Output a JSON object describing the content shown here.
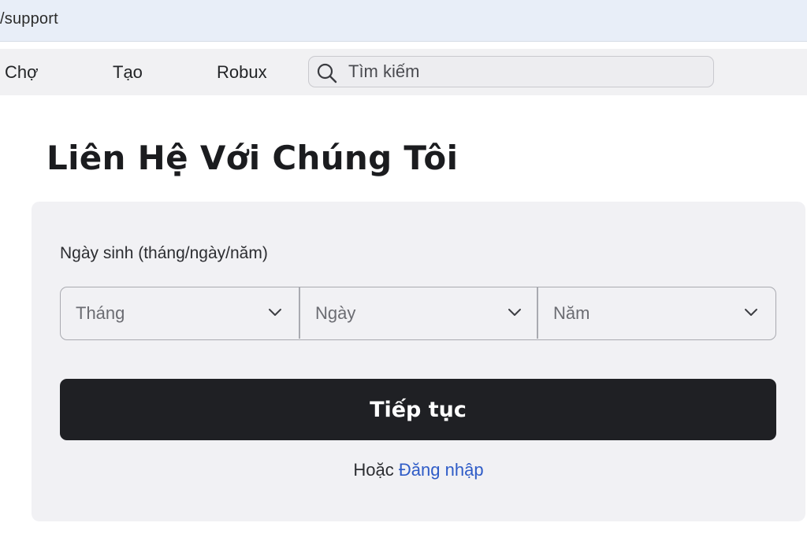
{
  "browser": {
    "url": "/support"
  },
  "nav": {
    "items": [
      {
        "label": "Chợ"
      },
      {
        "label": "Tạo"
      },
      {
        "label": "Robux"
      }
    ],
    "search_placeholder": "Tìm kiếm",
    "search_icon": "search-icon"
  },
  "page": {
    "title": "Liên Hệ Với Chúng Tôi"
  },
  "form": {
    "dob_label": "Ngày sinh (tháng/ngày/năm)",
    "month_placeholder": "Tháng",
    "day_placeholder": "Ngày",
    "year_placeholder": "Năm",
    "continue_label": "Tiếp tục",
    "or_text": "Hoặc",
    "login_label": "Đăng nhập"
  },
  "colors": {
    "button_bg": "#1f2024",
    "link": "#2f5cc7",
    "card_bg": "#f1f1f4"
  }
}
